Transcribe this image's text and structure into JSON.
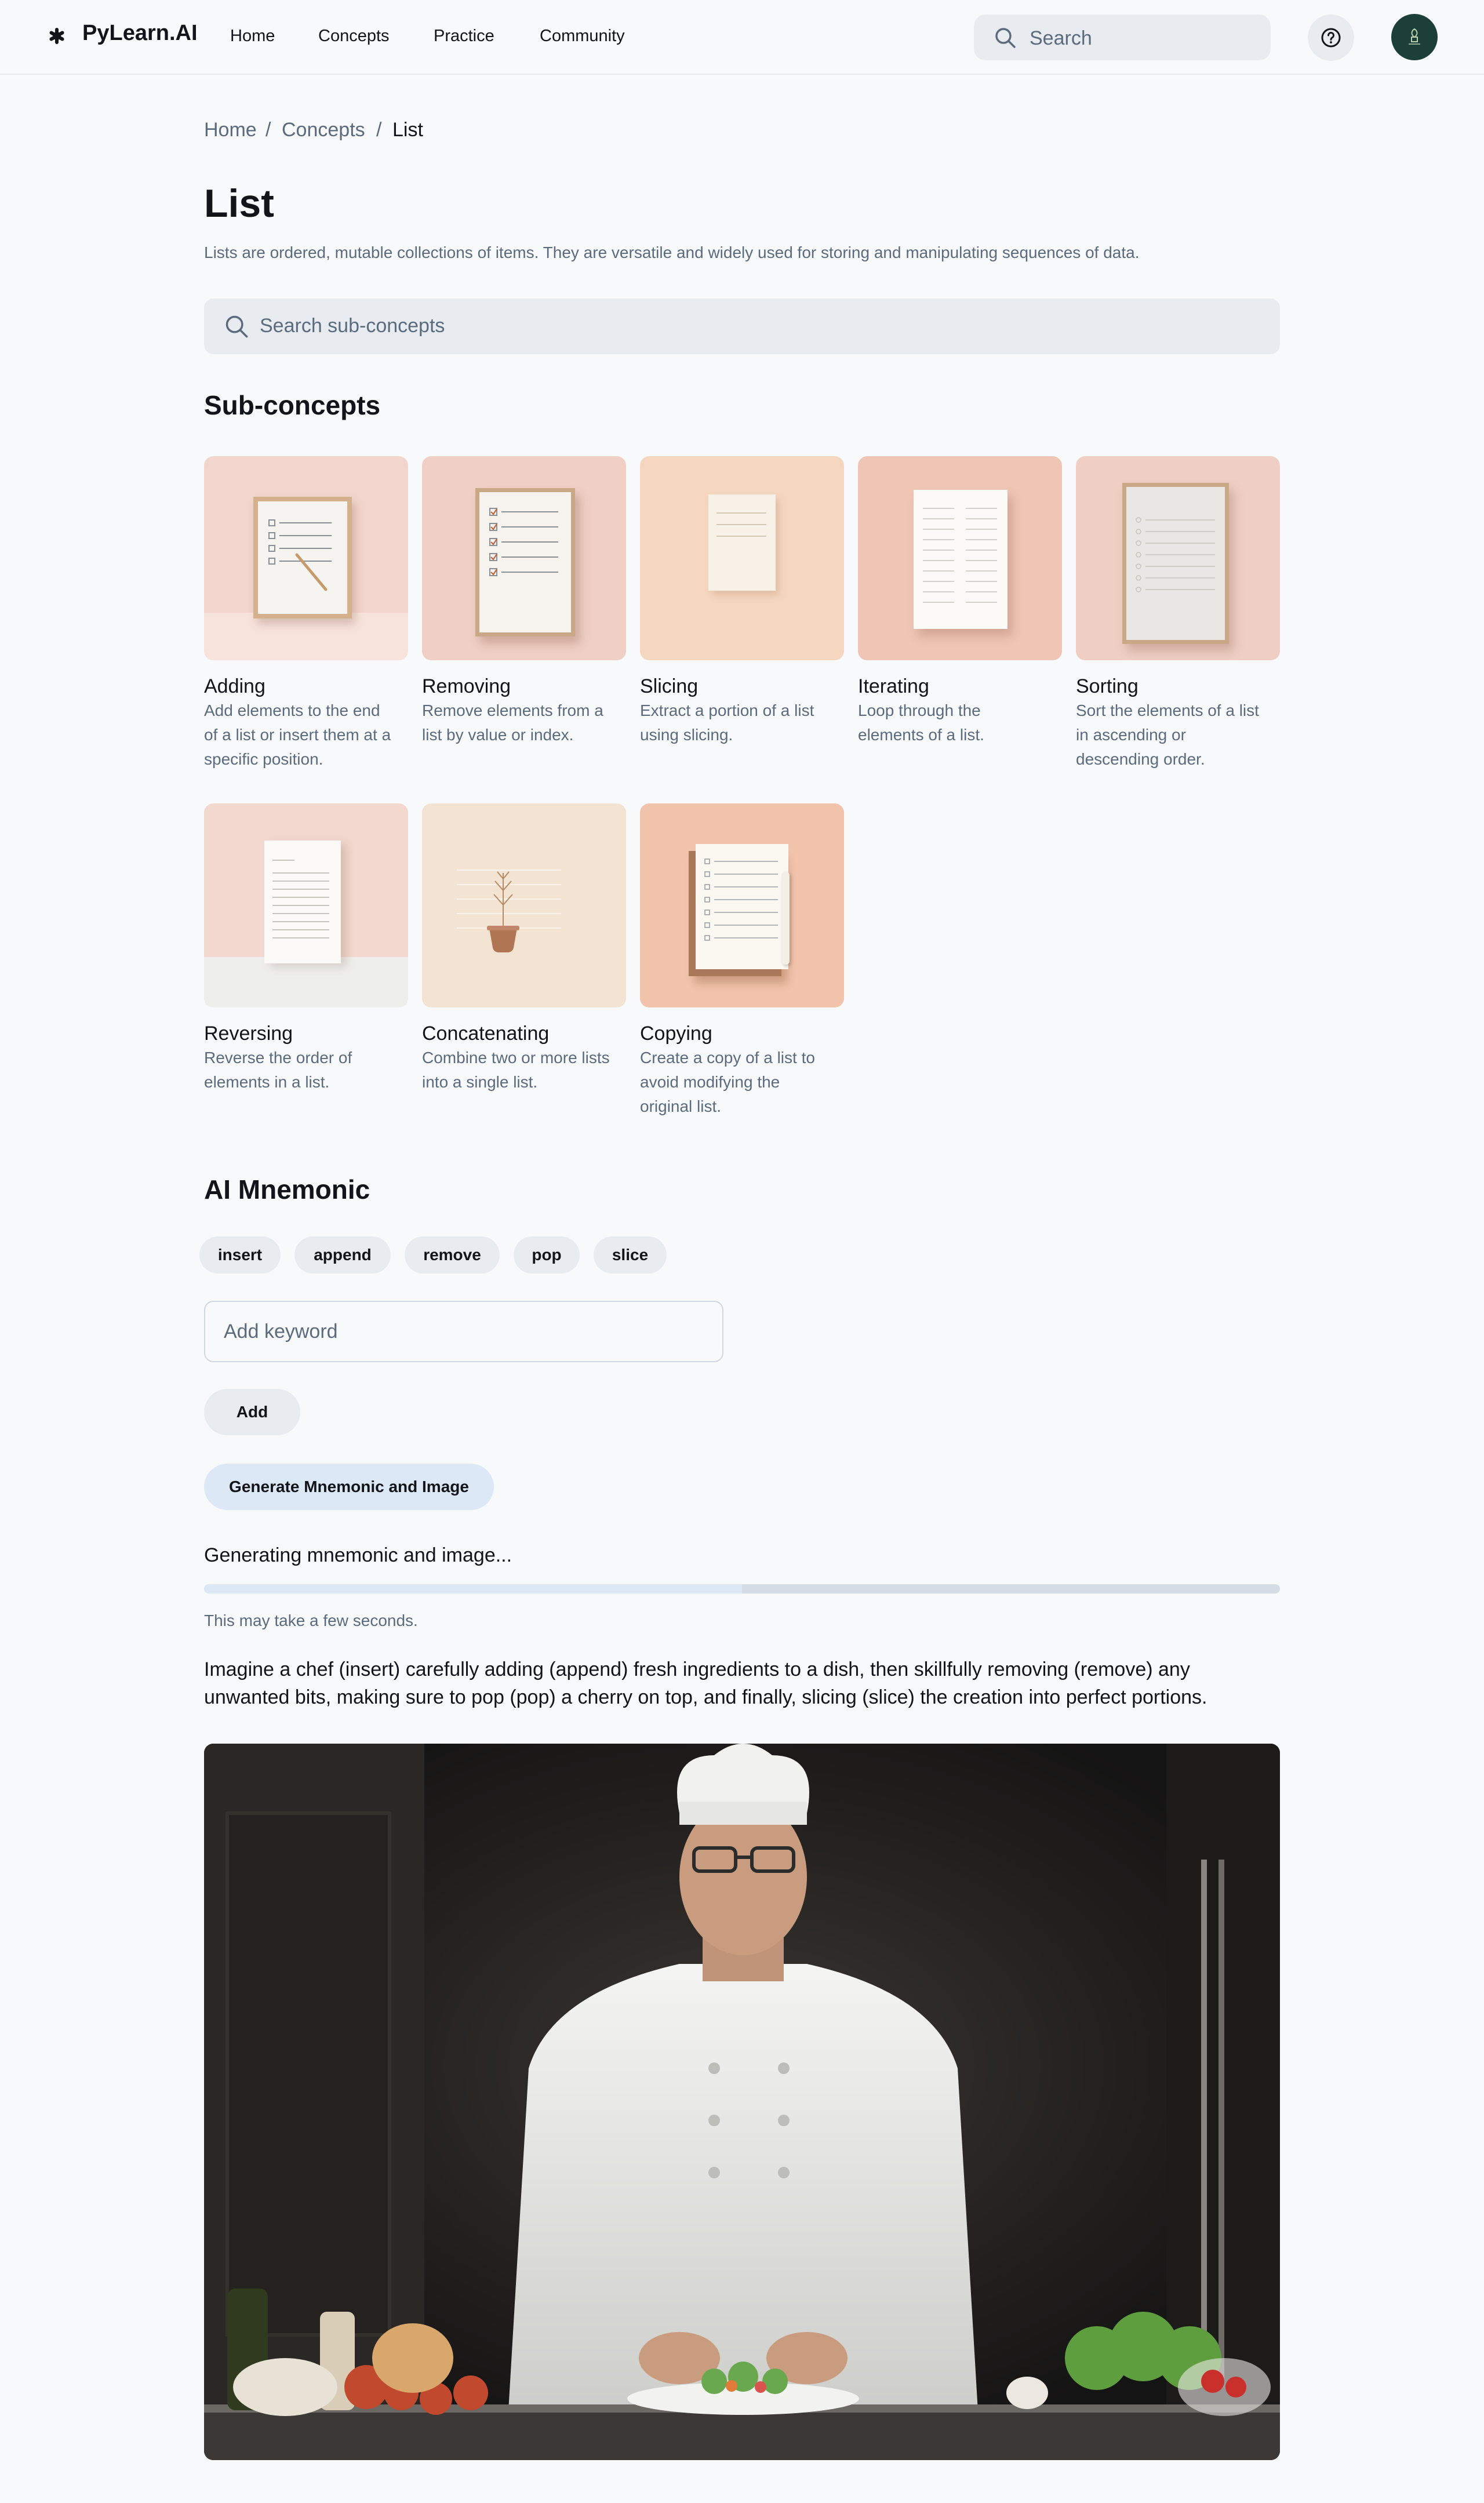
{
  "header": {
    "brand": "PyLearn.AI",
    "nav": [
      "Home",
      "Concepts",
      "Practice",
      "Community"
    ],
    "search_placeholder": "Search"
  },
  "breadcrumb": [
    "Home",
    "Concepts",
    "List"
  ],
  "page": {
    "title": "List",
    "description": "Lists are ordered, mutable collections of items. They are versatile and widely used for storing and manipulating sequences of data.",
    "sub_search_placeholder": "Search sub-concepts"
  },
  "subconcepts": {
    "heading": "Sub-concepts",
    "items": [
      {
        "title": "Adding",
        "desc": [
          "Add elements to the end",
          "of a list or insert them at a",
          "specific position."
        ]
      },
      {
        "title": "Removing",
        "desc": [
          "Remove elements from a",
          "list by value or index."
        ]
      },
      {
        "title": "Slicing",
        "desc": [
          "Extract a portion of a list",
          "using slicing."
        ]
      },
      {
        "title": "Iterating",
        "desc": [
          "Loop through the",
          "elements of a list."
        ]
      },
      {
        "title": "Sorting",
        "desc": [
          "Sort the elements of a list",
          "in ascending or",
          "descending order."
        ]
      },
      {
        "title": "Reversing",
        "desc": [
          "Reverse the order of",
          "elements in a list."
        ]
      },
      {
        "title": "Concatenating",
        "desc": [
          "Combine two or more lists",
          "into a single list."
        ]
      },
      {
        "title": "Copying",
        "desc": [
          "Create a copy of a list to",
          "avoid modifying the",
          "original list."
        ]
      }
    ]
  },
  "mnemonic": {
    "heading": "AI Mnemonic",
    "keywords": [
      "insert",
      "append",
      "remove",
      "pop",
      "slice"
    ],
    "keyword_placeholder": "Add keyword",
    "add_label": "Add",
    "generate_label": "Generate Mnemonic and Image",
    "status": "Generating mnemonic and image...",
    "progress": 0.5,
    "hint": "This may take a few seconds.",
    "text": "Imagine a chef (insert) carefully adding (append) fresh ingredients to a dish, then skillfully removing (remove) any unwanted bits, making sure to pop (pop) a cherry on top, and finally, slicing (slice) the creation into perfect portions."
  },
  "colors": {
    "background": "#f7f9fb",
    "chip": "#e8ecf1",
    "primary_button": "#dce8f5",
    "muted_text": "#5b6b7d",
    "avatar": "#1c3f3a"
  }
}
